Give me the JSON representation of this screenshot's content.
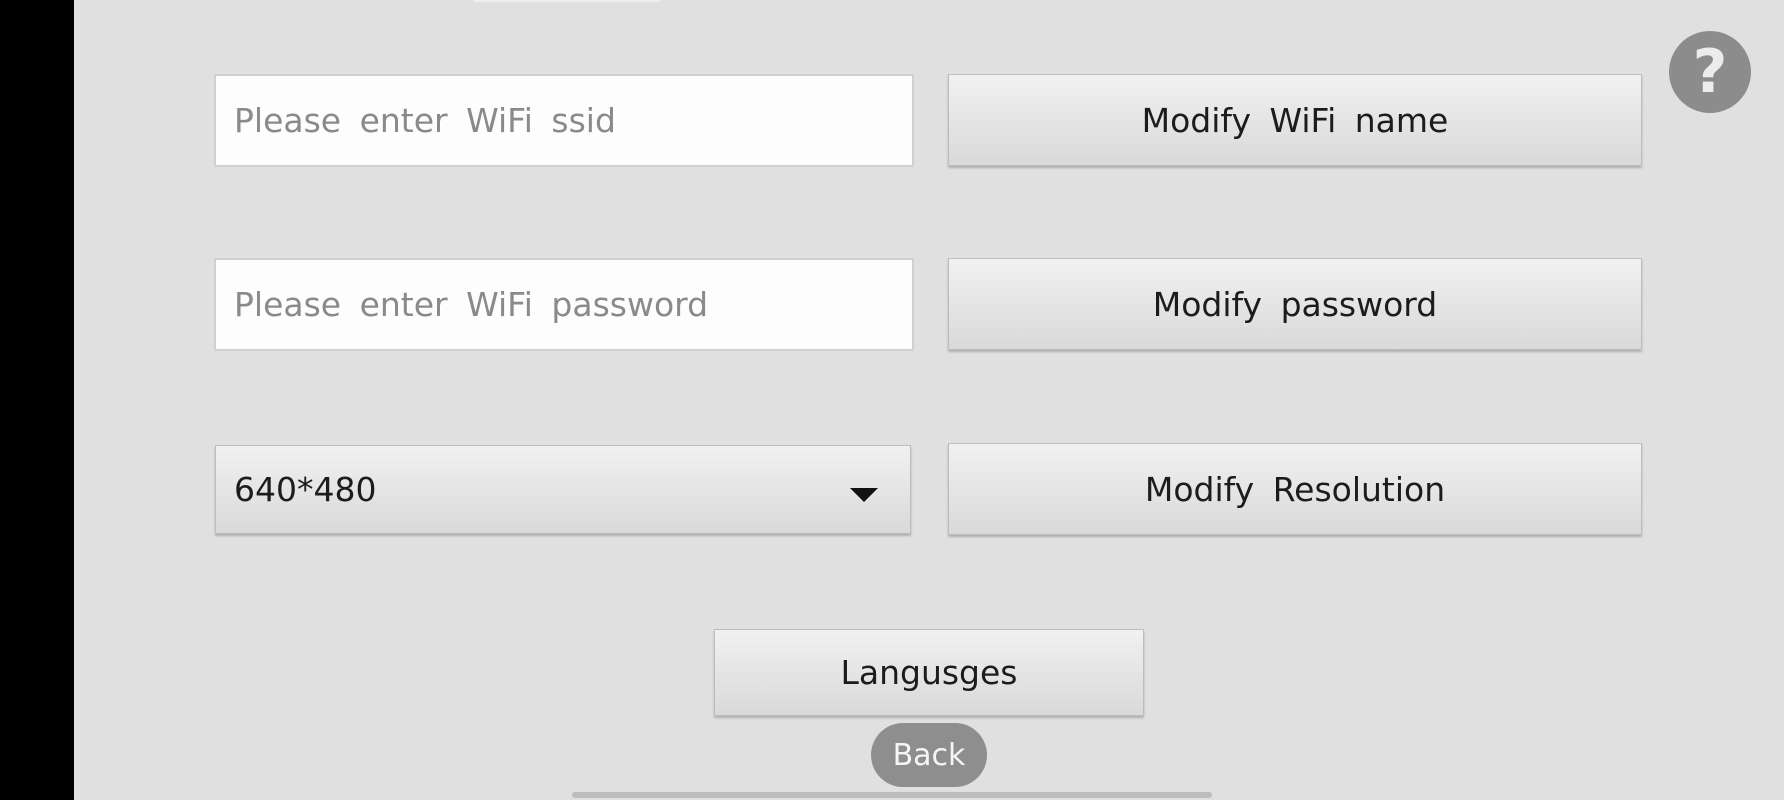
{
  "wifi": {
    "ssid_placeholder": "Please enter WiFi ssid",
    "ssid_value": "",
    "password_placeholder": "Please enter WiFi password",
    "password_value": "",
    "modify_name_label": "Modify WiFi name",
    "modify_password_label": "Modify password"
  },
  "resolution": {
    "selected": "640*480",
    "modify_label": "Modify Resolution"
  },
  "languages_label": "Langusges",
  "back_label": "Back",
  "help_symbol": "?",
  "icons": {
    "help": "question-mark-icon",
    "dropdown": "caret-down-icon"
  },
  "colors": {
    "screen_background": "#e0e0e0",
    "help_button": "#8c8c8c",
    "back_button": "#8e8e8e"
  }
}
